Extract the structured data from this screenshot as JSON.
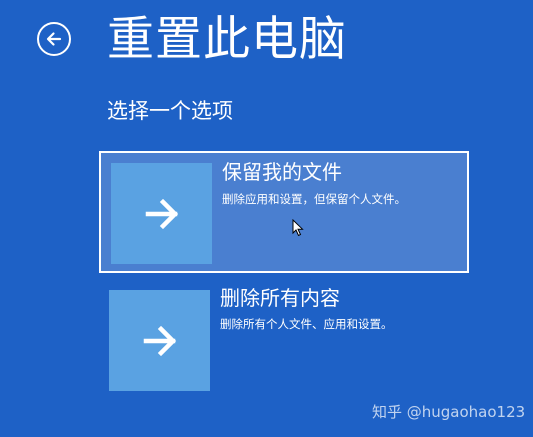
{
  "page": {
    "title": "重置此电脑",
    "subtitle": "选择一个选项",
    "back_icon": "back-arrow-circle-icon"
  },
  "options": [
    {
      "title": "保留我的文件",
      "description": "删除应用和设置，但保留个人文件。",
      "icon": "arrow-right-icon",
      "selected": true
    },
    {
      "title": "删除所有内容",
      "description": "删除所有个人文件、应用和设置。",
      "icon": "arrow-right-icon",
      "selected": false
    }
  ],
  "watermark": "知乎 @hugaohao123",
  "colors": {
    "background": "#1e61c6",
    "selected_option": "#4a7fd0",
    "tile": "#5aa2e2",
    "text": "#ffffff"
  }
}
